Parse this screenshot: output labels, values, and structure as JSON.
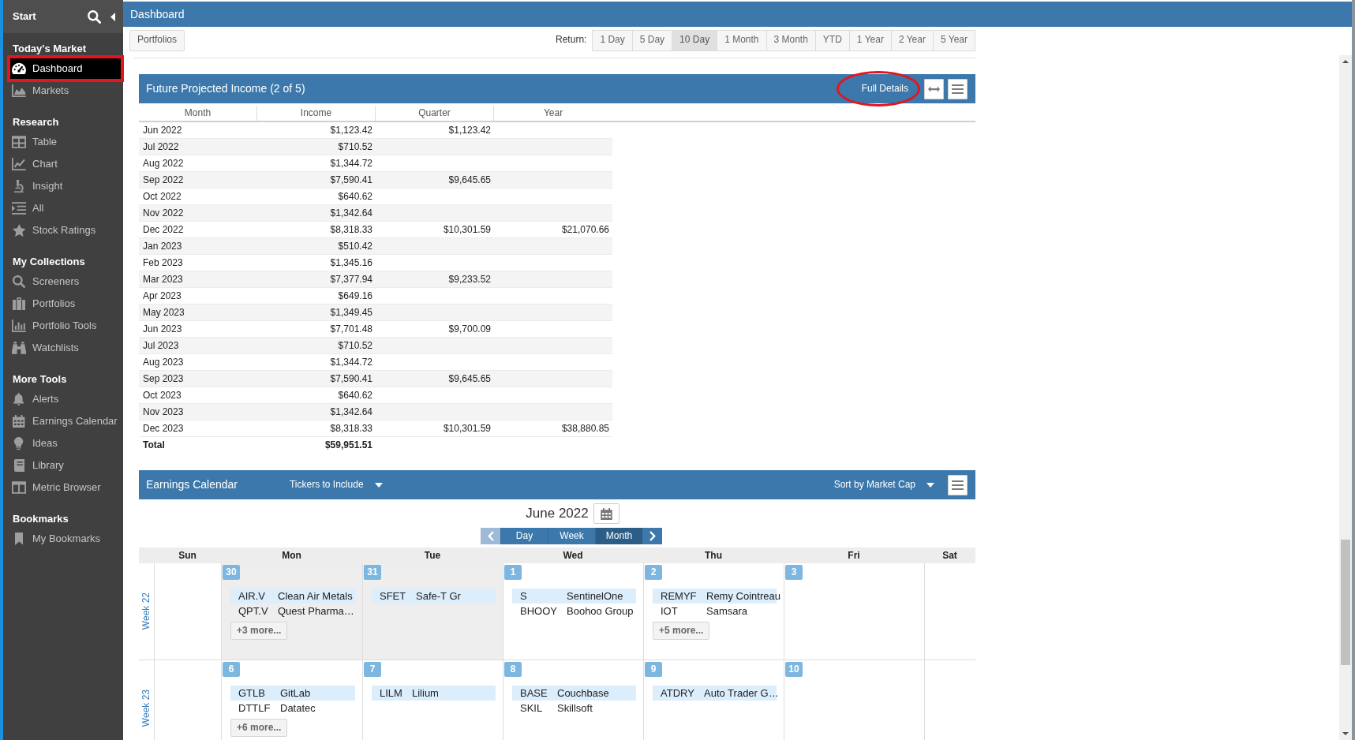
{
  "sidebar": {
    "title": "Start",
    "sections": [
      {
        "heading": "Today's Market",
        "items": [
          {
            "label": "Dashboard",
            "selected": true,
            "outlined": true
          },
          {
            "label": "Markets",
            "selected": false,
            "outlined": false
          }
        ]
      },
      {
        "heading": "Research",
        "items": [
          {
            "label": "Table",
            "selected": false,
            "outlined": false
          },
          {
            "label": "Chart",
            "selected": false,
            "outlined": false
          },
          {
            "label": "Insight",
            "selected": false,
            "outlined": false
          },
          {
            "label": "All",
            "selected": false,
            "outlined": false
          },
          {
            "label": "Stock Ratings",
            "selected": false,
            "outlined": false
          }
        ]
      },
      {
        "heading": "My Collections",
        "items": [
          {
            "label": "Screeners",
            "selected": false,
            "outlined": false
          },
          {
            "label": "Portfolios",
            "selected": false,
            "outlined": false
          },
          {
            "label": "Portfolio Tools",
            "selected": false,
            "outlined": false
          },
          {
            "label": "Watchlists",
            "selected": false,
            "outlined": false
          }
        ]
      },
      {
        "heading": "More Tools",
        "items": [
          {
            "label": "Alerts",
            "selected": false,
            "outlined": false
          },
          {
            "label": "Earnings Calendar",
            "selected": false,
            "outlined": false
          },
          {
            "label": "Ideas",
            "selected": false,
            "outlined": false
          },
          {
            "label": "Library",
            "selected": false,
            "outlined": false
          },
          {
            "label": "Metric Browser",
            "selected": false,
            "outlined": false
          }
        ]
      },
      {
        "heading": "Bookmarks",
        "items": [
          {
            "label": "My Bookmarks",
            "selected": false,
            "outlined": false
          }
        ]
      }
    ]
  },
  "title_bar": {
    "title": "Dashboard"
  },
  "toolbar": {
    "portfolios_button": "Portfolios",
    "return_label": "Return:",
    "periods": [
      {
        "label": "1 Day",
        "selected": false
      },
      {
        "label": "5 Day",
        "selected": false
      },
      {
        "label": "10 Day",
        "selected": true
      },
      {
        "label": "1 Month",
        "selected": false
      },
      {
        "label": "3 Month",
        "selected": false
      },
      {
        "label": "YTD",
        "selected": false
      },
      {
        "label": "1 Year",
        "selected": false
      },
      {
        "label": "2 Year",
        "selected": false
      },
      {
        "label": "5 Year",
        "selected": false
      }
    ]
  },
  "income_panel": {
    "title": "Future Projected Income (2 of 5)",
    "full_details": {
      "label": "Full Details",
      "circled": true
    },
    "table": {
      "columns": [
        "Month",
        "Income",
        "Quarter",
        "Year"
      ],
      "rows": [
        {
          "month": "Jun 2022",
          "income": "$1,123.42",
          "quarter": "$1,123.42"
        },
        {
          "month": "Jul 2022",
          "income": "$710.52"
        },
        {
          "month": "Aug 2022",
          "income": "$1,344.72"
        },
        {
          "month": "Sep 2022",
          "income": "$7,590.41",
          "quarter": "$9,645.65"
        },
        {
          "month": "Oct 2022",
          "income": "$640.62"
        },
        {
          "month": "Nov 2022",
          "income": "$1,342.64"
        },
        {
          "month": "Dec 2022",
          "income": "$8,318.33",
          "quarter": "$10,301.59",
          "year": "$21,070.66"
        },
        {
          "month": "Jan 2023",
          "income": "$510.42"
        },
        {
          "month": "Feb 2023",
          "income": "$1,345.16"
        },
        {
          "month": "Mar 2023",
          "income": "$7,377.94",
          "quarter": "$9,233.52"
        },
        {
          "month": "Apr 2023",
          "income": "$649.16"
        },
        {
          "month": "May 2023",
          "income": "$1,349.45"
        },
        {
          "month": "Jun 2023",
          "income": "$7,701.48",
          "quarter": "$9,700.09"
        },
        {
          "month": "Jul 2023",
          "income": "$710.52"
        },
        {
          "month": "Aug 2023",
          "income": "$1,344.72"
        },
        {
          "month": "Sep 2023",
          "income": "$7,590.41",
          "quarter": "$9,645.65"
        },
        {
          "month": "Oct 2023",
          "income": "$640.62"
        },
        {
          "month": "Nov 2023",
          "income": "$1,342.64"
        },
        {
          "month": "Dec 2023",
          "income": "$8,318.33",
          "quarter": "$10,301.59",
          "year": "$38,880.85"
        }
      ],
      "total": {
        "label": "Total",
        "income": "$59,951.51"
      }
    }
  },
  "earnings_calendar": {
    "title": "Earnings Calendar",
    "tickers_filter": "Tickers to Include",
    "sort_by": "Sort by Market Cap",
    "month": "June 2022",
    "prev": {
      "disabled": true
    },
    "views": [
      {
        "label": "Day",
        "selected": false
      },
      {
        "label": "Week",
        "selected": false
      },
      {
        "label": "Month",
        "selected": true
      }
    ],
    "next": {
      "disabled": false
    },
    "weekdays": [
      "Sun",
      "Mon",
      "Tue",
      "Wed",
      "Thu",
      "Fri",
      "Sat"
    ],
    "weeks": [
      {
        "label": "Week 22",
        "days": [
          {
            "outside_month": false
          },
          {
            "date": "30",
            "outside_month": true,
            "events": [
              {
                "ticker": "AIR.V",
                "name": "Clean Air Metals",
                "highlighted": true
              },
              {
                "ticker": "QPT.V",
                "name": "Quest Pharma…",
                "highlighted": false
              }
            ],
            "more": "+3 more..."
          },
          {
            "date": "31",
            "outside_month": true,
            "events": [
              {
                "ticker": "SFET",
                "name": "Safe-T Gr",
                "highlighted": true
              }
            ]
          },
          {
            "date": "1",
            "outside_month": false,
            "events": [
              {
                "ticker": "S",
                "name": "SentinelOne",
                "highlighted": true
              },
              {
                "ticker": "BHOOY",
                "name": "Boohoo Group",
                "highlighted": false
              }
            ]
          },
          {
            "date": "2",
            "outside_month": false,
            "events": [
              {
                "ticker": "REMYF",
                "name": "Remy Cointreau",
                "highlighted": true
              },
              {
                "ticker": "IOT",
                "name": "Samsara",
                "highlighted": false
              }
            ],
            "more": "+5 more..."
          },
          {
            "date": "3",
            "outside_month": false
          },
          {
            "outside_month": false
          }
        ]
      },
      {
        "label": "Week 23",
        "days": [
          {
            "outside_month": false
          },
          {
            "date": "6",
            "outside_month": false,
            "events": [
              {
                "ticker": "GTLB",
                "name": "GitLab",
                "highlighted": true
              },
              {
                "ticker": "DTTLF",
                "name": "Datatec",
                "highlighted": false
              }
            ],
            "more": "+6 more..."
          },
          {
            "date": "7",
            "outside_month": false,
            "events": [
              {
                "ticker": "LILM",
                "name": "Lilium",
                "highlighted": true
              }
            ]
          },
          {
            "date": "8",
            "outside_month": false,
            "events": [
              {
                "ticker": "BASE",
                "name": "Couchbase",
                "highlighted": true
              },
              {
                "ticker": "SKIL",
                "name": "Skillsoft",
                "highlighted": false
              }
            ]
          },
          {
            "date": "9",
            "outside_month": false,
            "events": [
              {
                "ticker": "ATDRY",
                "name": "Auto Trader G…",
                "highlighted": true
              }
            ]
          },
          {
            "date": "10",
            "outside_month": false
          },
          {
            "outside_month": false
          }
        ]
      }
    ]
  }
}
